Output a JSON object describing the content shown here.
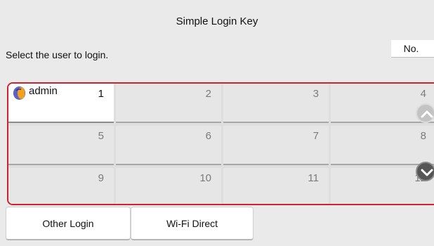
{
  "header": {
    "title": "Simple Login Key",
    "prompt": "Select the user to login.",
    "no_label": "No."
  },
  "keys": [
    {
      "number": "1",
      "user": "admin",
      "avatar_icon": "user-avatar-icon",
      "selected": true
    },
    {
      "number": "2",
      "user": ""
    },
    {
      "number": "3",
      "user": ""
    },
    {
      "number": "4",
      "user": ""
    },
    {
      "number": "5",
      "user": ""
    },
    {
      "number": "6",
      "user": ""
    },
    {
      "number": "7",
      "user": ""
    },
    {
      "number": "8",
      "user": ""
    },
    {
      "number": "9",
      "user": ""
    },
    {
      "number": "10",
      "user": ""
    },
    {
      "number": "11",
      "user": ""
    },
    {
      "number": "12",
      "user": ""
    }
  ],
  "scroll": {
    "up_icon": "chevron-up-icon",
    "down_icon": "chevron-down-icon"
  },
  "footer": {
    "other_login_label": "Other Login",
    "wifi_direct_label": "Wi-Fi Direct"
  },
  "colors": {
    "frame": "#d0222c",
    "background": "#eaeaea",
    "key": "#e6e6e6",
    "selected_key": "#ffffff"
  }
}
